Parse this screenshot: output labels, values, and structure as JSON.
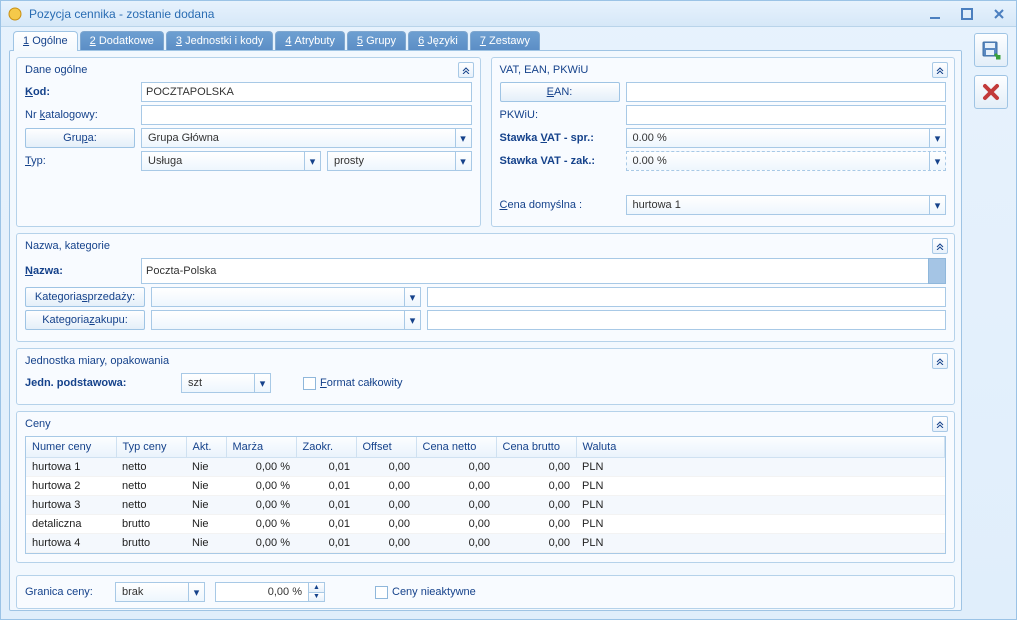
{
  "window": {
    "title": "Pozycja cennika - zostanie dodana"
  },
  "tabs": [
    {
      "n": "1",
      "l": "Ogólne"
    },
    {
      "n": "2",
      "l": "Dodatkowe"
    },
    {
      "n": "3",
      "l": "Jednostki i kody"
    },
    {
      "n": "4",
      "l": "Atrybuty"
    },
    {
      "n": "5",
      "l": "Grupy"
    },
    {
      "n": "6",
      "l": "Języki"
    },
    {
      "n": "7",
      "l": "Zestawy"
    }
  ],
  "dane_ogolne": {
    "title": "Dane ogólne",
    "kod_label": "Kod:",
    "kod_value": "POCZTAPOLSKA",
    "nrkat_label_pre": "Nr ",
    "nrkat_label_u": "k",
    "nrkat_label_post": "atalogowy:",
    "grupa_btn_pre": "Gru",
    "grupa_btn_u": "p",
    "grupa_btn_post": "a:",
    "grupa_value": "Grupa Główna",
    "typ_label_u": "T",
    "typ_label_post": "yp:",
    "typ_value": "Usługa",
    "typ2_value": "prosty"
  },
  "vat": {
    "title": "VAT, EAN, PKWiU",
    "ean_btn_u": "E",
    "ean_btn_post": "AN:",
    "pkwiu_label": "PKWiU:",
    "stawka_spr_pre": "Stawka ",
    "stawka_spr_u": "V",
    "stawka_spr_post": "AT - spr.:",
    "stawka_spr_val": "0.00  %",
    "stawka_zak_label": "Stawka VAT - zak.:",
    "stawka_zak_val": "0.00  %",
    "cena_dom_pre": "",
    "cena_dom_u": "C",
    "cena_dom_post": "ena domyślna :",
    "cena_dom_val": "hurtowa 1"
  },
  "nazwa": {
    "title": "Nazwa, kategorie",
    "nazwa_label_u": "N",
    "nazwa_label_post": "azwa:",
    "nazwa_value": "Poczta-Polska",
    "kat_sprz_pre": "Kategoria ",
    "kat_sprz_u": "s",
    "kat_sprz_post": "przedaży:",
    "kat_zak_pre": "Kategoria ",
    "kat_zak_u": "z",
    "kat_zak_post": "akupu:"
  },
  "jednostka": {
    "title": "Jednostka miary, opakowania",
    "podst_label": "Jedn. podstawowa:",
    "podst_value": "szt",
    "format_u": "F",
    "format_post": "ormat całkowity"
  },
  "ceny": {
    "title": "Ceny",
    "headers": [
      "Numer ceny",
      "Typ ceny",
      "Akt.",
      "Marża",
      "Zaokr.",
      "Offset",
      "Cena netto",
      "Cena brutto",
      "Waluta"
    ],
    "rows": [
      {
        "num": "hurtowa 1",
        "typ": "netto",
        "akt": "Nie",
        "marza": "0,00 %",
        "zaokr": "0,01",
        "offset": "0,00",
        "netto": "0,00",
        "brutto": "0,00",
        "waluta": "PLN"
      },
      {
        "num": "hurtowa 2",
        "typ": "netto",
        "akt": "Nie",
        "marza": "0,00 %",
        "zaokr": "0,01",
        "offset": "0,00",
        "netto": "0,00",
        "brutto": "0,00",
        "waluta": "PLN"
      },
      {
        "num": "hurtowa 3",
        "typ": "netto",
        "akt": "Nie",
        "marza": "0,00 %",
        "zaokr": "0,01",
        "offset": "0,00",
        "netto": "0,00",
        "brutto": "0,00",
        "waluta": "PLN"
      },
      {
        "num": "detaliczna",
        "typ": "brutto",
        "akt": "Nie",
        "marza": "0,00 %",
        "zaokr": "0,01",
        "offset": "0,00",
        "netto": "0,00",
        "brutto": "0,00",
        "waluta": "PLN"
      },
      {
        "num": "hurtowa 4",
        "typ": "brutto",
        "akt": "Nie",
        "marza": "0,00 %",
        "zaokr": "0,01",
        "offset": "0,00",
        "netto": "0,00",
        "brutto": "0,00",
        "waluta": "PLN"
      }
    ]
  },
  "bottom": {
    "granica_label": "Granica ceny:",
    "granica_value": "brak",
    "spin_value": "0,00 %",
    "nieaktywne_label": "Ceny nieaktywne"
  }
}
